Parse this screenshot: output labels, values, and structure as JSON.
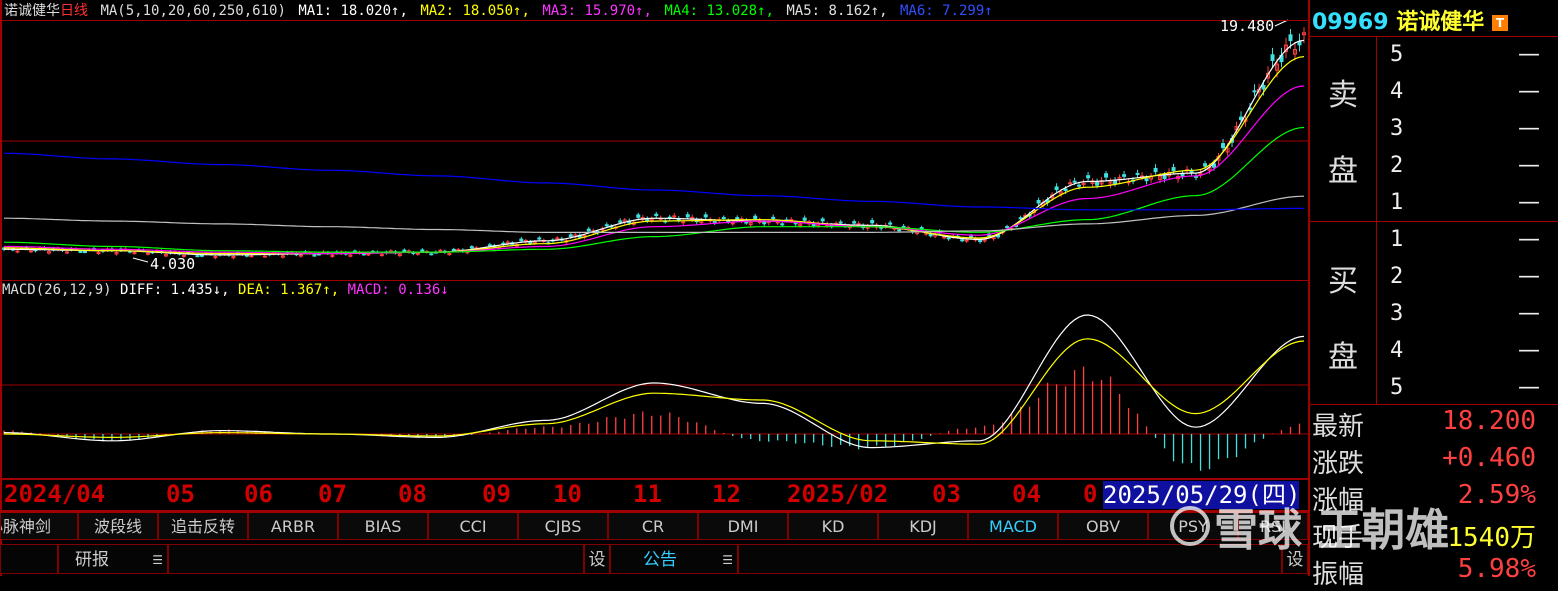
{
  "ma_header": {
    "name": "诺诚健华",
    "period": "日线",
    "params": "MA(5,10,20,60,250,610)",
    "ma1": "MA1: 18.020↑,",
    "ma2": "MA2: 18.050↑,",
    "ma3": "MA3: 15.970↑,",
    "ma4": "MA4: 13.028↑,",
    "ma5": "MA5: 8.162↑,",
    "ma6": "MA6: 7.299↑"
  },
  "macd_header": {
    "params": "MACD(26,12,9)",
    "diff": "DIFF: 1.435↓,",
    "dea": "DEA: 1.367↑,",
    "macd": "MACD: 0.136↓"
  },
  "annotations": {
    "high_label": "19.480",
    "low_label": "4.030"
  },
  "months": [
    "2024/04",
    "05",
    "06",
    "07",
    "08",
    "09",
    "10",
    "11",
    "12",
    "2025/02",
    "03",
    "04",
    "0"
  ],
  "selected_date": "2025/05/29(四)",
  "indicator_tabs": [
    "心脉神剑",
    "波段线",
    "追击反转",
    "ARBR",
    "BIAS",
    "CCI",
    "CJBS",
    "CR",
    "DMI",
    "KD",
    "KDJ",
    "MACD",
    "OBV",
    "PSY",
    "RSI"
  ],
  "active_tab": "MACD",
  "bottom_bar": {
    "research": "研报",
    "settings": "设",
    "announcement": "公告",
    "settings2": "设"
  },
  "quote_panel": {
    "code": "09969",
    "name": "诺诚健华",
    "badge": "T",
    "sell_label_1": "卖",
    "sell_label_2": "盘",
    "buy_label_1": "买",
    "buy_label_2": "盘",
    "sell_levels": [
      "5",
      "4",
      "3",
      "2",
      "1"
    ],
    "buy_levels": [
      "1",
      "2",
      "3",
      "4",
      "5"
    ],
    "dash": "—",
    "rows": [
      {
        "label": "最新",
        "value": "18.200"
      },
      {
        "label": "涨跌",
        "value": "+0.460"
      },
      {
        "label": "涨幅",
        "value": "2.59%"
      },
      {
        "label": "现手",
        "value": "1540万"
      },
      {
        "label": "振幅",
        "value": "5.98%"
      }
    ]
  },
  "watermark": "雪球 王朝雄",
  "colors": {
    "up": "#ff4040",
    "down": "#40e0e0",
    "ma1": "#ffffff",
    "ma2": "#ffff00",
    "ma3": "#ff00ff",
    "ma4": "#00ff00",
    "ma5": "#c0c0c0",
    "ma6": "#0000ff",
    "grid": "#a00000"
  },
  "chart_data": [
    {
      "type": "line",
      "title": "MA(5,10,20,60,250,610)",
      "note": "candlestick price chart, values approximate",
      "x": [
        "2024/04",
        "05",
        "06",
        "07",
        "08",
        "09",
        "10",
        "11",
        "12",
        "2025/02",
        "03",
        "04",
        "05"
      ],
      "series": [
        {
          "name": "MA1",
          "values": [
            4.4,
            4.3,
            4.0,
            4.1,
            4.2,
            5.0,
            6.6,
            6.4,
            6.1,
            5.1,
            9.2,
            9.8,
            19.2
          ]
        },
        {
          "name": "MA2",
          "values": [
            4.5,
            4.3,
            4.1,
            4.1,
            4.2,
            4.8,
            6.4,
            6.5,
            6.0,
            5.2,
            8.8,
            10.0,
            18.05
          ]
        },
        {
          "name": "MA3",
          "values": [
            4.6,
            4.4,
            4.2,
            4.1,
            4.2,
            4.6,
            6.0,
            6.4,
            6.0,
            5.4,
            8.0,
            9.6,
            15.97
          ]
        },
        {
          "name": "MA4",
          "values": [
            4.9,
            4.6,
            4.3,
            4.2,
            4.2,
            4.4,
            5.3,
            6.0,
            6.0,
            5.6,
            6.5,
            8.2,
            13.03
          ]
        },
        {
          "name": "MA5",
          "values": [
            6.6,
            6.4,
            6.2,
            6.0,
            5.8,
            5.6,
            5.6,
            5.6,
            5.6,
            5.7,
            6.2,
            6.8,
            8.16
          ]
        },
        {
          "name": "MA6",
          "values": [
            11.2,
            10.8,
            10.4,
            10.0,
            9.6,
            9.1,
            8.6,
            8.2,
            7.8,
            7.4,
            7.2,
            7.2,
            7.3
          ]
        }
      ],
      "annotations": [
        "19.480",
        "4.030"
      ]
    },
    {
      "type": "bar",
      "title": "MACD(26,12,9)",
      "x": [
        "2024/04",
        "05",
        "06",
        "07",
        "08",
        "09",
        "10",
        "11",
        "12",
        "2025/02",
        "03",
        "04",
        "05"
      ],
      "series": [
        {
          "name": "DIFF",
          "values": [
            0.02,
            -0.1,
            0.05,
            0.0,
            -0.05,
            0.2,
            0.75,
            0.45,
            -0.2,
            -0.1,
            1.75,
            0.1,
            1.435
          ]
        },
        {
          "name": "DEA",
          "values": [
            0.0,
            -0.05,
            0.02,
            0.0,
            -0.03,
            0.15,
            0.6,
            0.5,
            -0.1,
            -0.15,
            1.4,
            0.3,
            1.367
          ]
        },
        {
          "name": "MACD",
          "values": [
            0.05,
            -0.1,
            0.06,
            0.0,
            -0.05,
            0.1,
            0.3,
            -0.1,
            -0.2,
            0.1,
            0.9,
            -0.5,
            0.136
          ]
        }
      ]
    }
  ]
}
